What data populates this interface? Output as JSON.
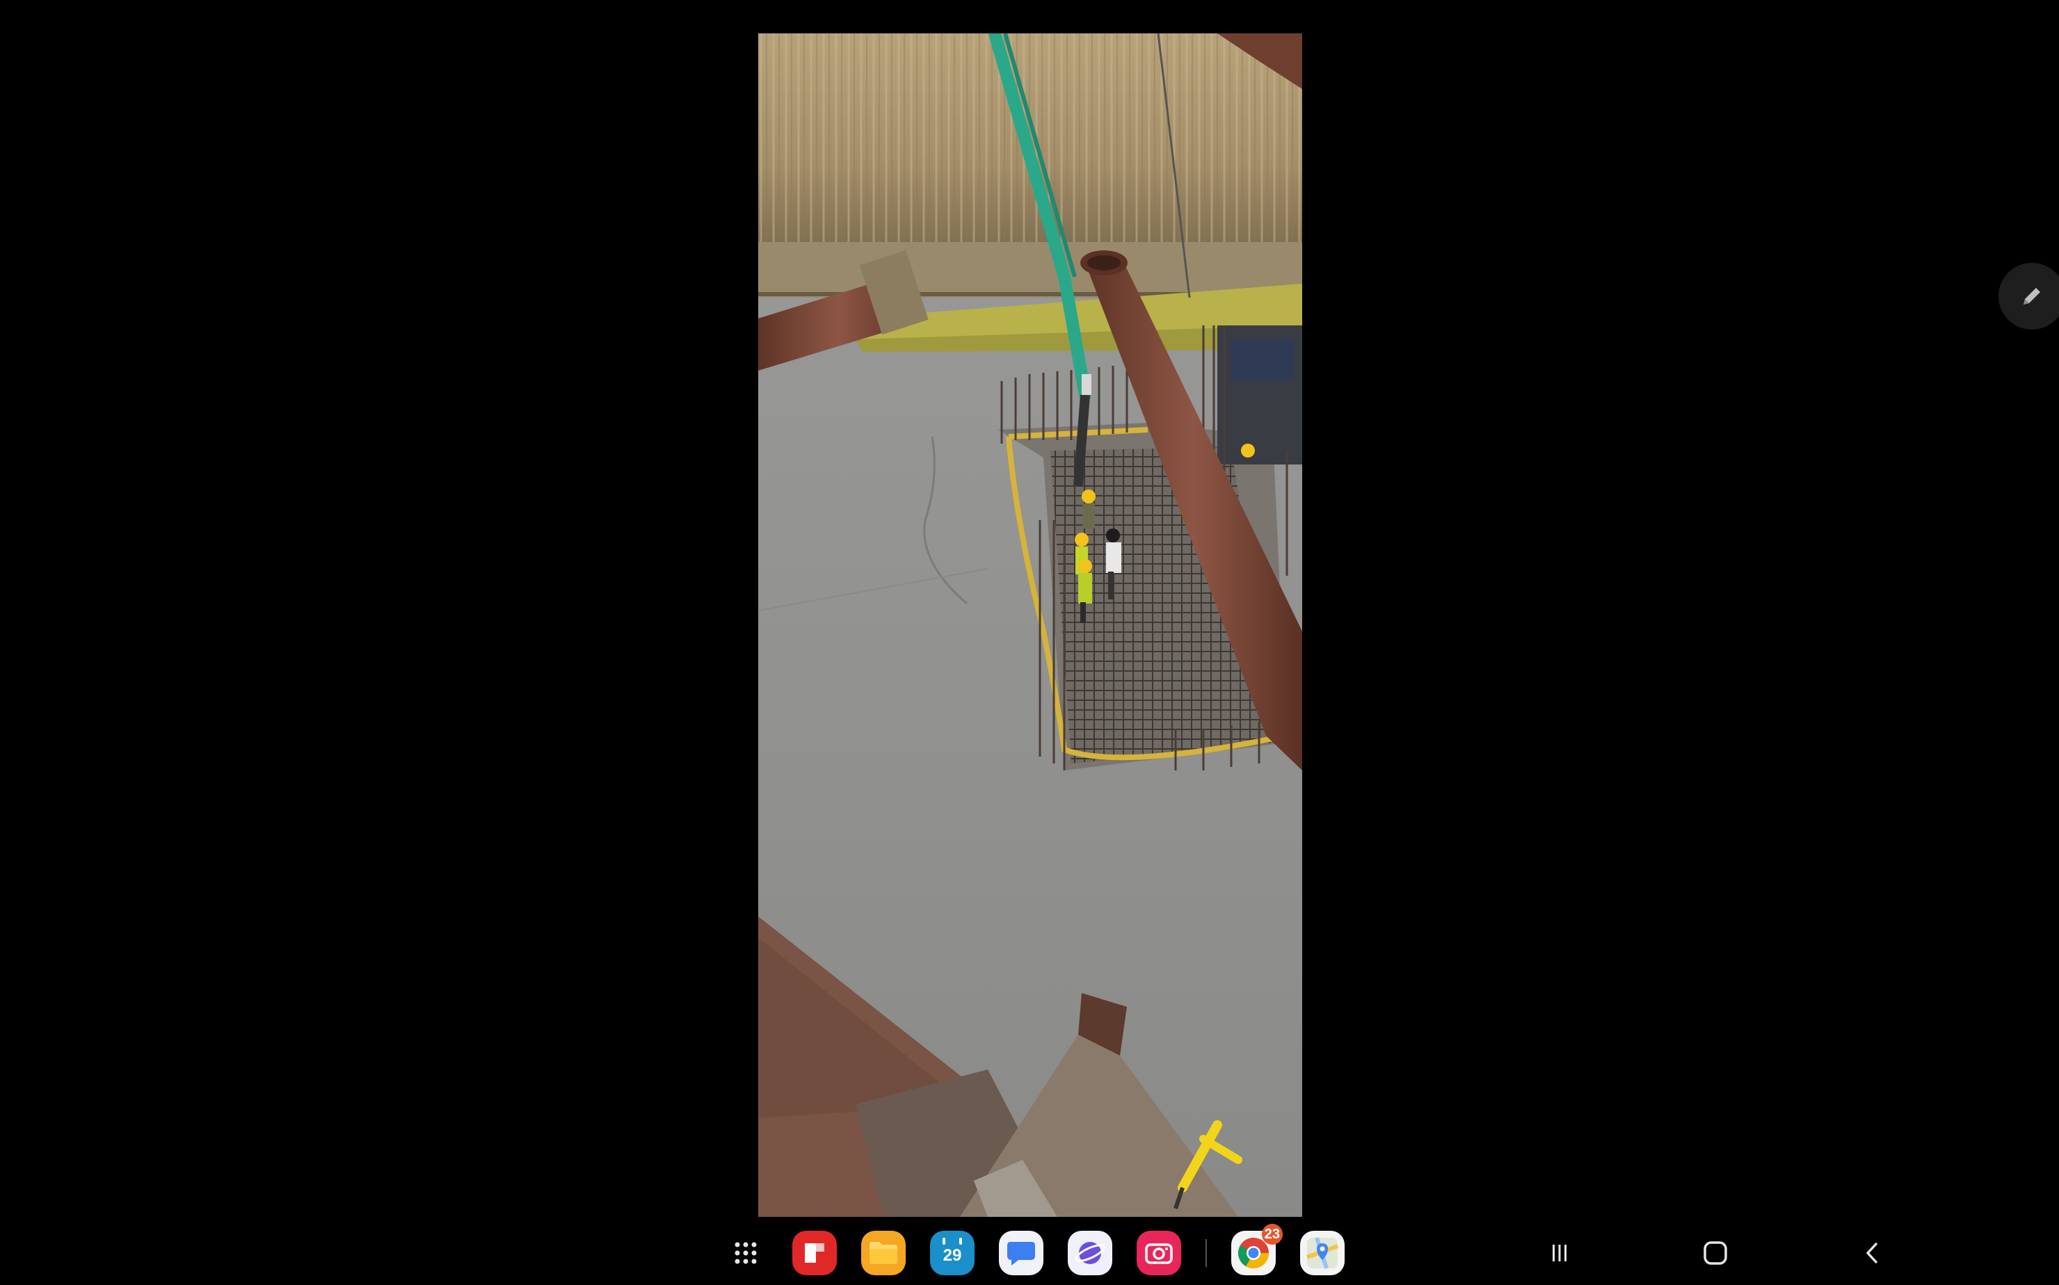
{
  "viewer": {
    "photo_subject": "construction-site-concrete-pour"
  },
  "edit_button": {
    "icon": "pencil-icon"
  },
  "taskbar": {
    "apps": [
      {
        "name": "apps-grid",
        "icon": "apps-grid-icon"
      },
      {
        "name": "flipboard",
        "icon": "flipboard-icon",
        "color": "#e12828"
      },
      {
        "name": "my-files",
        "icon": "folder-icon",
        "color": "#f5a623"
      },
      {
        "name": "calendar",
        "icon": "calendar-icon",
        "color": "#1a8fc9",
        "date": "29"
      },
      {
        "name": "messages",
        "icon": "chat-bubble-icon",
        "color": "#3d7ff0"
      },
      {
        "name": "internet",
        "icon": "planet-icon",
        "color": "#6a4fe0"
      },
      {
        "name": "screen-recorder",
        "icon": "camera-icon",
        "color": "#e8265a"
      },
      {
        "name": "chrome",
        "icon": "chrome-icon",
        "badge": "23"
      },
      {
        "name": "maps",
        "icon": "maps-icon"
      }
    ],
    "nav": {
      "recents": "recents-icon",
      "home": "home-icon",
      "back": "back-icon"
    }
  }
}
